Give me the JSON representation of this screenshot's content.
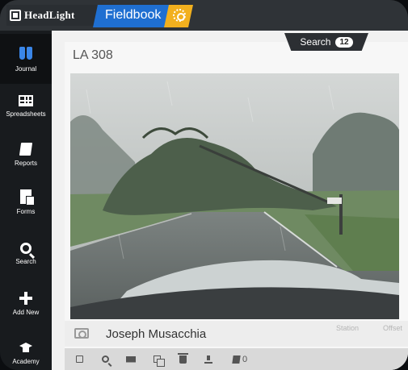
{
  "header": {
    "logo_text": "HeadLight",
    "app_name": "Fieldbook",
    "settings_icon": "gear-icon",
    "colors": {
      "app_tab": "#1f6fd1",
      "settings_tab": "#f2b01e",
      "bar": "#2f3337"
    }
  },
  "sidebar": {
    "items": [
      {
        "label": "Journal",
        "icon": "binoculars-icon",
        "active": true
      },
      {
        "label": "Spreadsheets",
        "icon": "grid-icon"
      },
      {
        "label": "Reports",
        "icon": "book-icon"
      },
      {
        "label": "Forms",
        "icon": "forms-icon"
      },
      {
        "label": "Search",
        "icon": "search-icon"
      },
      {
        "label": "Add New",
        "icon": "plus-icon"
      },
      {
        "label": "Academy",
        "icon": "graduation-cap-icon"
      }
    ]
  },
  "search_tab": {
    "label": "Search",
    "count": "12"
  },
  "entry": {
    "title": "LA 308",
    "photo_alt": "Fallen tree across a rainy road viewed through a windshield",
    "author": "Joseph Musacchia",
    "columns": [
      "Station",
      "Offset"
    ],
    "toolbar": {
      "icons": [
        "checkbox-icon",
        "zoom-icon",
        "email-icon",
        "duplicate-icon",
        "trash-icon",
        "download-icon",
        "notes-icon"
      ],
      "notes_count": "0"
    }
  }
}
